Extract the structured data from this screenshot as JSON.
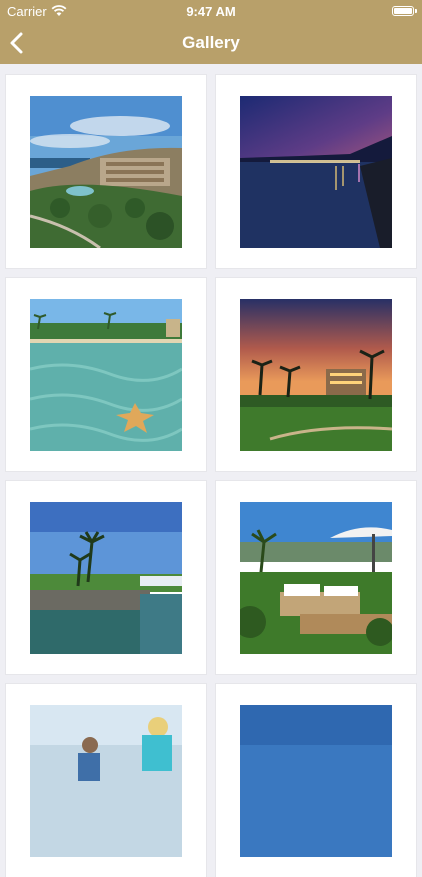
{
  "status": {
    "carrier": "Carrier",
    "time": "9:47 AM"
  },
  "nav": {
    "title": "Gallery"
  },
  "colors": {
    "accent": "#b8a06a",
    "background": "#efeff4"
  },
  "gallery": {
    "photos": [
      {
        "subject": "resort-hillside"
      },
      {
        "subject": "night-bay"
      },
      {
        "subject": "starfish-lagoon"
      },
      {
        "subject": "sunset-palms"
      },
      {
        "subject": "marina-palms"
      },
      {
        "subject": "pool-sunbeds"
      },
      {
        "subject": "couple-beach"
      },
      {
        "subject": "blue-sky"
      }
    ]
  }
}
